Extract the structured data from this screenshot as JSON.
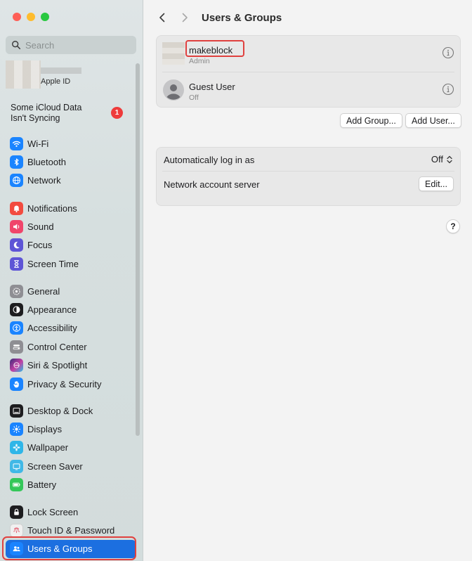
{
  "window": {
    "traffic_lights": {
      "close": "#fe5f57",
      "minimize": "#febc2e",
      "zoom": "#28c840"
    }
  },
  "sidebar": {
    "search": {
      "placeholder": "Search",
      "value": ""
    },
    "apple_id": {
      "label": "Apple ID"
    },
    "icloud_notice": {
      "line1": "Some iCloud Data",
      "line2": "Isn't Syncing",
      "badge": "1"
    },
    "groups": [
      [
        {
          "label": "Wi-Fi",
          "icon": "wifi-icon",
          "color": "#1a84ff"
        },
        {
          "label": "Bluetooth",
          "icon": "bluetooth-icon",
          "color": "#1a84ff"
        },
        {
          "label": "Network",
          "icon": "globe-icon",
          "color": "#1a84ff"
        }
      ],
      [
        {
          "label": "Notifications",
          "icon": "bell-icon",
          "color": "#f24b3f"
        },
        {
          "label": "Sound",
          "icon": "speaker-icon",
          "color": "#f0456b"
        },
        {
          "label": "Focus",
          "icon": "moon-icon",
          "color": "#5e55d6"
        },
        {
          "label": "Screen Time",
          "icon": "hourglass-icon",
          "color": "#5e55d6"
        }
      ],
      [
        {
          "label": "General",
          "icon": "gear-icon",
          "color": "#8e8e93"
        },
        {
          "label": "Appearance",
          "icon": "appearance-icon",
          "color": "#1d1d1f"
        },
        {
          "label": "Accessibility",
          "icon": "accessibility-icon",
          "color": "#1a84ff"
        },
        {
          "label": "Control Center",
          "icon": "control-center-icon",
          "color": "#8e8e93"
        },
        {
          "label": "Siri & Spotlight",
          "icon": "siri-icon",
          "color": "#7a3bd6"
        },
        {
          "label": "Privacy & Security",
          "icon": "hand-icon",
          "color": "#1a84ff"
        }
      ],
      [
        {
          "label": "Desktop & Dock",
          "icon": "dock-icon",
          "color": "#1d1d1f"
        },
        {
          "label": "Displays",
          "icon": "sun-icon",
          "color": "#1a84ff"
        },
        {
          "label": "Wallpaper",
          "icon": "flower-icon",
          "color": "#2fb6e8"
        },
        {
          "label": "Screen Saver",
          "icon": "screen-saver-icon",
          "color": "#41b8e6"
        },
        {
          "label": "Battery",
          "icon": "battery-icon",
          "color": "#34c759"
        }
      ],
      [
        {
          "label": "Lock Screen",
          "icon": "lock-icon",
          "color": "#1d1d1f"
        },
        {
          "label": "Touch ID & Password",
          "icon": "fingerprint-icon",
          "color": "#f0f0f0"
        },
        {
          "label": "Users & Groups",
          "icon": "users-icon",
          "color": "#1a84ff",
          "active": true
        }
      ]
    ]
  },
  "main": {
    "title": "Users & Groups",
    "users": [
      {
        "name": "makeblock",
        "role": "Admin"
      },
      {
        "name": "Guest User",
        "role": "Off"
      }
    ],
    "add_group_label": "Add Group...",
    "add_user_label": "Add User...",
    "settings": {
      "auto_login_label": "Automatically log in as",
      "auto_login_value": "Off",
      "network_server_label": "Network account server",
      "edit_label": "Edit..."
    },
    "help_label": "?"
  }
}
